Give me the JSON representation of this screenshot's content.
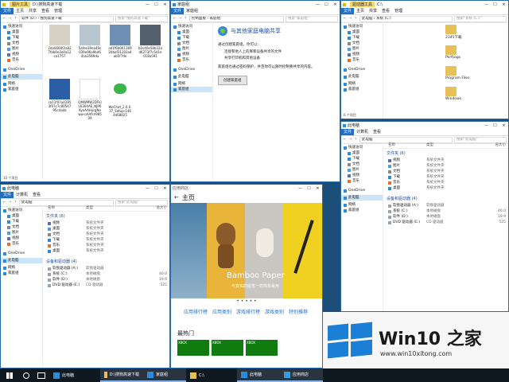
{
  "windows": {
    "downloads": {
      "title_path": "D:\\搜狗高速下载",
      "context_tab": "图片工具",
      "tabs": [
        "文件",
        "主页",
        "共享",
        "查看",
        "管理"
      ],
      "address": "软件 (D:) › 搜狗高速下载",
      "search": "搜索\"搜狗高速下载\"",
      "nav": [
        "快速访问",
        "桌面",
        "下载",
        "文档",
        "图片",
        "视频",
        "音乐",
        "OneDrive",
        "此电脑",
        "网络",
        "家庭组"
      ],
      "nav_selected": 8,
      "files": [
        {
          "name": "2de0660f2a827fab0e3e0a12ca1757",
          "color": "#d8d2c6"
        },
        {
          "name": "5afee39ea49c039e96a9bd64aa3569da",
          "color": "#b8c6cf"
        },
        {
          "name": "ad1f6b0613692dbaf31203a4ab5f7de",
          "color": "#6f8fb5"
        },
        {
          "name": "b2c40e58b22ad6273f7c5d1e018a591",
          "color": "#55606e"
        },
        {
          "name": "ca11f07a42853f07c7c8054795cdada",
          "color": "#2a5fa8"
        },
        {
          "name": "QMWMW2DFkIL6304AE_NJPKKyoAAHurgNeww-oAAfsn98509",
          "color": "#ffffff"
        },
        {
          "name": "WeChat_2.0.0.37_Setup-1464468025",
          "color": "#3ab54a"
        }
      ],
      "status": "10 个项目"
    },
    "homegroup": {
      "title": "家庭组",
      "tabs": [
        "文件",
        "家庭组"
      ],
      "address": "控制面板 › 家庭组",
      "search": "搜索\"家庭组\"",
      "nav": [
        "快速访问",
        "桌面",
        "下载",
        "文档",
        "图片",
        "视频",
        "音乐",
        "OneDrive",
        "此电脑",
        "网络",
        "家庭组"
      ],
      "nav_selected": 10,
      "heading": "与其他家庭电脑共享",
      "line1": "通过创建家庭组，你可以：",
      "bullet1": "连接和他人上的库和设备共享的文件",
      "bullet2": "共享打印机和其他设备",
      "line2": "家庭组也通过密码保护，并且你可以随时控制要共享的内容。",
      "button": "创建家庭组"
    },
    "cdrive": {
      "title": "C:\\",
      "context_tab": "驱动器工具",
      "tabs": [
        "文件",
        "主页",
        "共享",
        "查看",
        "管理"
      ],
      "address": "此电脑 › 系统 (C:)",
      "search": "搜索\"系统 (C:)\"",
      "nav": [
        "快速访问",
        "桌面",
        "下载",
        "文档",
        "图片",
        "视频",
        "音乐",
        "OneDrive",
        "此电脑",
        "网络",
        "家庭组"
      ],
      "nav_selected": -1,
      "folders": [
        "2345下载",
        "PerfLogs",
        "Program Files",
        "Windows"
      ],
      "status": "6 个项目"
    },
    "thispc_right": {
      "title": "此电脑",
      "tabs": [
        "文件",
        "计算机",
        "查看"
      ],
      "address": "此电脑",
      "search": "搜索\"此电脑\"",
      "nav": [
        "快速访问",
        "桌面",
        "下载",
        "文档",
        "图片",
        "视频",
        "音乐",
        "OneDrive",
        "此电脑",
        "网络",
        "家庭组"
      ],
      "nav_selected": 8,
      "col_name": "名称",
      "col_type": "类型",
      "col_size": "总大小",
      "folders_header": "文件夹 (6)",
      "folders": [
        {
          "name": "视频",
          "type": "系统文件夹"
        },
        {
          "name": "图片",
          "type": "系统文件夹"
        },
        {
          "name": "文档",
          "type": "系统文件夹"
        },
        {
          "name": "下载",
          "type": "系统文件夹"
        },
        {
          "name": "音乐",
          "type": "系统文件夹"
        },
        {
          "name": "桌面",
          "type": "系统文件夹"
        }
      ],
      "devices_header": "设备和驱动器 (4)",
      "devices": [
        {
          "name": "软盘驱动器 (A:)",
          "type": "软盘驱动器",
          "size": ""
        },
        {
          "name": "系统 (C:)",
          "type": "本地磁盘",
          "size": "40.0"
        },
        {
          "name": "软件 (D:)",
          "type": "本地磁盘",
          "size": "19.9"
        },
        {
          "name": "DVD 驱动器 (E:)",
          "type": "CD 驱动器",
          "size": "525"
        }
      ]
    },
    "thispc_left": {
      "title": "此电脑",
      "tabs": [
        "文件",
        "计算机",
        "查看"
      ],
      "address": "此电脑",
      "search": "搜索\"此电脑\"",
      "nav": [
        "快速访问",
        "桌面",
        "下载",
        "文档",
        "图片",
        "视频",
        "音乐",
        "OneDrive",
        "此电脑",
        "网络",
        "家庭组"
      ],
      "nav_selected": 8,
      "col_name": "名称",
      "col_type": "类型",
      "col_size": "总大小",
      "folders_header": "文件夹 (6)",
      "folders": [
        {
          "name": "视频",
          "type": "系统文件夹"
        },
        {
          "name": "桌面",
          "type": "系统文件夹"
        },
        {
          "name": "文档",
          "type": "系统文件夹"
        },
        {
          "name": "下载",
          "type": "系统文件夹"
        },
        {
          "name": "音乐",
          "type": "系统文件夹"
        },
        {
          "name": "桌面",
          "type": "系统文件夹"
        }
      ],
      "devices_header": "设备和驱动器 (4)",
      "devices": [
        {
          "name": "软盘驱动器 (A:)",
          "type": "软盘驱动器",
          "size": ""
        },
        {
          "name": "系统 (C:)",
          "type": "本地磁盘",
          "size": "40.0"
        },
        {
          "name": "软件 (D:)",
          "type": "本地磁盘",
          "size": "19.9"
        },
        {
          "name": "DVD 驱动器 (E:)",
          "type": "CD 驱动器",
          "size": "525"
        }
      ]
    },
    "store": {
      "title": "应用商店",
      "home": "主页",
      "hero_title": "Bamboo Paper",
      "hero_sub": "与真实的纸笔一样简单易用",
      "links": [
        "应用排行榜",
        "应用类别",
        "游戏排行榜",
        "游戏类别",
        "特别推荐"
      ],
      "section": "最热门",
      "tile_label": "XBOX"
    }
  },
  "watermark": {
    "brand": "Win10 之家",
    "url": "www.win10xitong.com"
  },
  "taskbar": {
    "items": [
      "此电脑",
      "D:\\搜狗高速下载",
      "家庭组",
      "C:\\",
      "此电脑",
      "应用商店"
    ],
    "active": [
      false,
      true,
      true,
      false,
      true,
      true
    ]
  },
  "colors": {
    "accent": "#1e6fc8",
    "folder": "#e8c05a",
    "desktop": "#1b4f7a"
  }
}
